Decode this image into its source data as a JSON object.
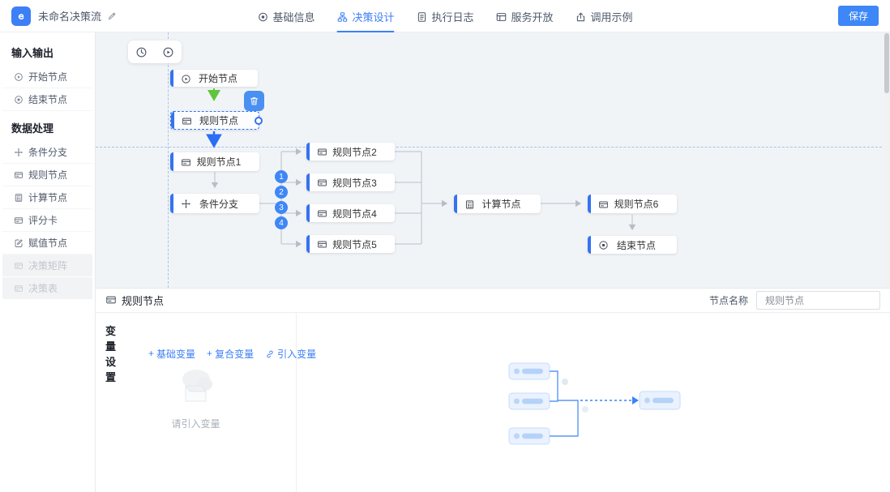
{
  "header": {
    "title": "未命名决策流",
    "save_label": "保存",
    "tabs": [
      {
        "label": "基础信息"
      },
      {
        "label": "决策设计"
      },
      {
        "label": "执行日志"
      },
      {
        "label": "服务开放"
      },
      {
        "label": "调用示例"
      }
    ]
  },
  "sidebar": {
    "sections": [
      {
        "title": "输入输出",
        "items": [
          {
            "label": "开始节点"
          },
          {
            "label": "结束节点"
          }
        ]
      },
      {
        "title": "数据处理",
        "items": [
          {
            "label": "条件分支"
          },
          {
            "label": "规则节点"
          },
          {
            "label": "计算节点"
          },
          {
            "label": "评分卡"
          },
          {
            "label": "赋值节点"
          },
          {
            "label": "决策矩阵",
            "disabled": true
          },
          {
            "label": "决策表",
            "disabled": true
          }
        ]
      }
    ]
  },
  "canvas": {
    "nodes": {
      "start": {
        "label": "开始节点"
      },
      "rule_selected": {
        "label": "规则节点"
      },
      "rule1": {
        "label": "规则节点1"
      },
      "branch": {
        "label": "条件分支"
      },
      "rule2": {
        "label": "规则节点2"
      },
      "rule3": {
        "label": "规则节点3"
      },
      "rule4": {
        "label": "规则节点4"
      },
      "rule5": {
        "label": "规则节点5"
      },
      "calc": {
        "label": "计算节点"
      },
      "rule6": {
        "label": "规则节点6"
      },
      "end": {
        "label": "结束节点"
      }
    },
    "branch_numbers": [
      "1",
      "2",
      "3",
      "4"
    ]
  },
  "panel": {
    "title": "规则节点",
    "node_name_label": "节点名称",
    "node_name_value": "规则节点",
    "variables_title": "变量设置",
    "links": [
      {
        "prefix": "+",
        "label": "基础变量"
      },
      {
        "prefix": "+",
        "label": "复合变量"
      },
      {
        "prefix": "",
        "label": "引入变量"
      }
    ],
    "empty_text": "请引入变量"
  },
  "colors": {
    "accent": "#3d7ff7",
    "node_bar": "#3573f0",
    "green_edge": "#5ec53c",
    "blue_edge": "#2a6ef5",
    "canvas_bg": "#f1f4f7"
  }
}
